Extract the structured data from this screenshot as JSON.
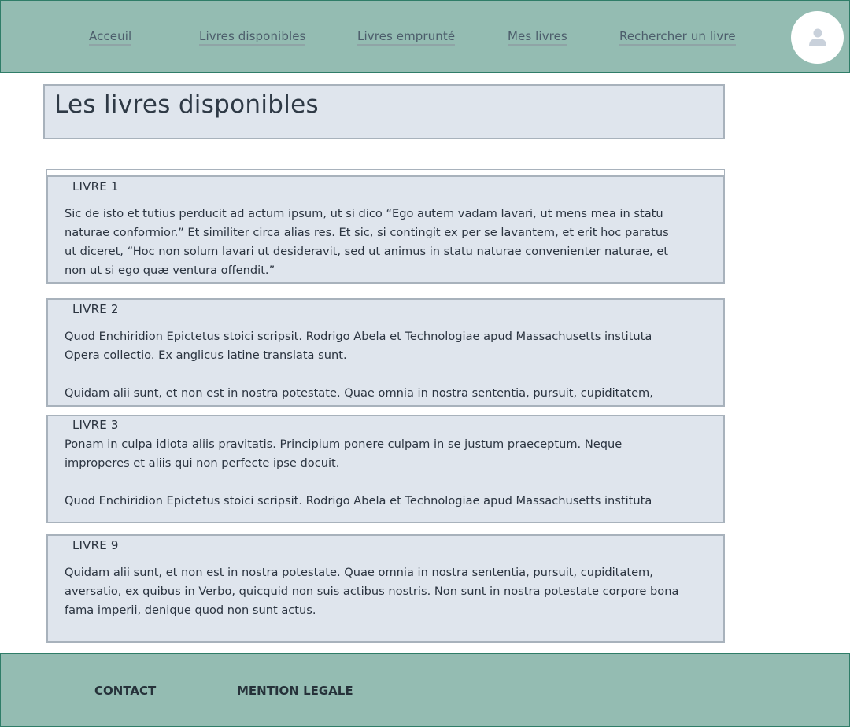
{
  "nav": {
    "items": [
      {
        "label": "Acceuil"
      },
      {
        "label": "Livres disponibles"
      },
      {
        "label": "Livres emprunté"
      },
      {
        "label": "Mes livres"
      },
      {
        "label": "Rechercher un livre"
      }
    ],
    "avatar_icon": "user-icon"
  },
  "main": {
    "title": "Les livres disponibles",
    "books": [
      {
        "title": "LIVRE 1",
        "lines": [
          "Sic de isto et tutius perducit ad actum ipsum, ut si dico “Ego autem vadam lavari, ut mens mea in statu",
          "naturae conformior.” Et similiter circa alias res. Et sic, si contingit ex per se lavantem, et erit hoc paratus",
          "ut diceret, “Hoc non solum lavari ut desideravit, sed ut animus in statu naturae convenienter naturae, et",
          "non ut si ego quæ ventura offendit.”"
        ]
      },
      {
        "title": "LIVRE 2",
        "lines": [
          "Quod Enchiridion Epictetus stoici scripsit. Rodrigo Abela et Technologiae apud Massachusetts instituta",
          "Opera collectio. Ex anglicus latine translata sunt.",
          "Quidam alii sunt, et non est in nostra potestate. Quae omnia in nostra sententia, pursuit, cupiditatem,"
        ]
      },
      {
        "title": "LIVRE 3",
        "lines": [
          "Ponam in culpa idiota aliis pravitatis. Principium ponere culpam in se justum praeceptum. Neque",
          "improperes et aliis qui non perfecte ipse docuit.",
          "Quod Enchiridion Epictetus stoici scripsit. Rodrigo Abela et Technologiae apud Massachusetts instituta"
        ]
      },
      {
        "title": "LIVRE 9",
        "lines": [
          "Quidam alii sunt, et non est in nostra potestate. Quae omnia in nostra sententia, pursuit, cupiditatem,",
          "aversatio, ex quibus in Verbo, quicquid non suis actibus nostris. Non sunt in nostra potestate corpore bona",
          "fama imperii, denique quod non sunt actus."
        ]
      }
    ]
  },
  "footer": {
    "contact": "CONTACT",
    "legal": "MENTION LEGALE"
  },
  "colors": {
    "header_bg": "#94bcb2",
    "card_bg": "#dfe5ed",
    "text": "#2b3440"
  }
}
